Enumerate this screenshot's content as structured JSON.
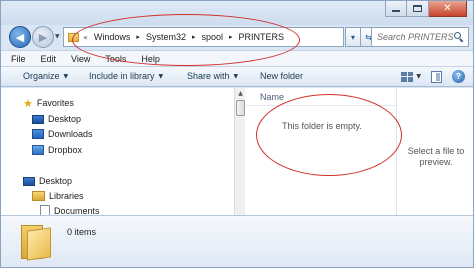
{
  "window": {
    "caption_buttons": {
      "minimize": "minimize-icon",
      "maximize": "maximize-icon",
      "close": "✕"
    }
  },
  "navigation": {
    "back_icon": "arrow-left-icon",
    "forward_icon": "arrow-right-icon"
  },
  "address_bar": {
    "overflow_chevron": "«",
    "breadcrumbs": [
      "Windows",
      "System32",
      "spool",
      "PRINTERS"
    ],
    "separator": "▸"
  },
  "address_buttons": {
    "dropdown": "▾",
    "refresh": "⇆"
  },
  "search": {
    "placeholder": "Search PRINTERS"
  },
  "menu": {
    "items": [
      "File",
      "Edit",
      "View",
      "Tools",
      "Help"
    ]
  },
  "command_bar": {
    "organize": "Organize",
    "include_in_library": "Include in library",
    "share_with": "Share with",
    "new_folder": "New folder",
    "dropdown_arrow": "▼",
    "help": "?"
  },
  "nav_pane": {
    "favorites_label": "Favorites",
    "favorites": [
      "Desktop",
      "Downloads",
      "Dropbox"
    ],
    "desktop_label": "Desktop",
    "libraries_label": "Libraries",
    "libraries": [
      "Documents"
    ]
  },
  "file_list": {
    "column_name": "Name",
    "empty_message": "This folder is empty."
  },
  "preview_pane": {
    "message": "Select a file to preview."
  },
  "details_pane": {
    "item_count": "0 items"
  },
  "annotations": {
    "color": "#d0312d"
  }
}
